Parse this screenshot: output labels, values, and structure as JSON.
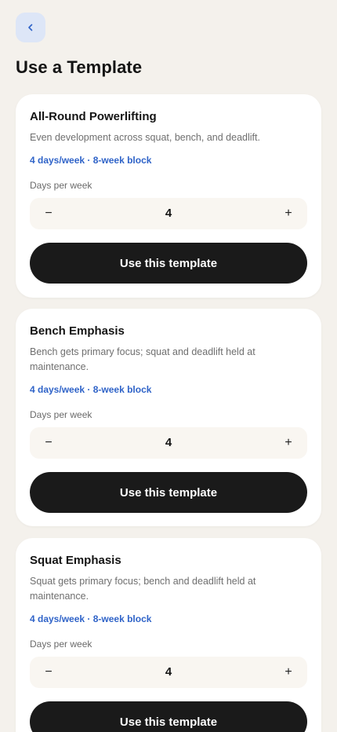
{
  "header": {
    "back_icon": "chevron-left-icon",
    "title": "Use a Template"
  },
  "colors": {
    "background": "#f4f1ec",
    "accent": "#2f63c8",
    "back_button_bg": "#dde6f7",
    "primary_button": "#1a1a1a"
  },
  "templates": [
    {
      "title": "All-Round Powerlifting",
      "description": "Even development across squat, bench, and deadlift.",
      "meta": "4 days/week · 8-week block",
      "days_label": "Days per week",
      "minus": "−",
      "days_value": "4",
      "plus": "+",
      "button_label": "Use this template"
    },
    {
      "title": "Bench Emphasis",
      "description": "Bench gets primary focus; squat and deadlift held at maintenance.",
      "meta": "4 days/week · 8-week block",
      "days_label": "Days per week",
      "minus": "−",
      "days_value": "4",
      "plus": "+",
      "button_label": "Use this template"
    },
    {
      "title": "Squat Emphasis",
      "description": "Squat gets primary focus; bench and deadlift held at maintenance.",
      "meta": "4 days/week · 8-week block",
      "days_label": "Days per week",
      "minus": "−",
      "days_value": "4",
      "plus": "+",
      "button_label": "Use this template"
    }
  ]
}
